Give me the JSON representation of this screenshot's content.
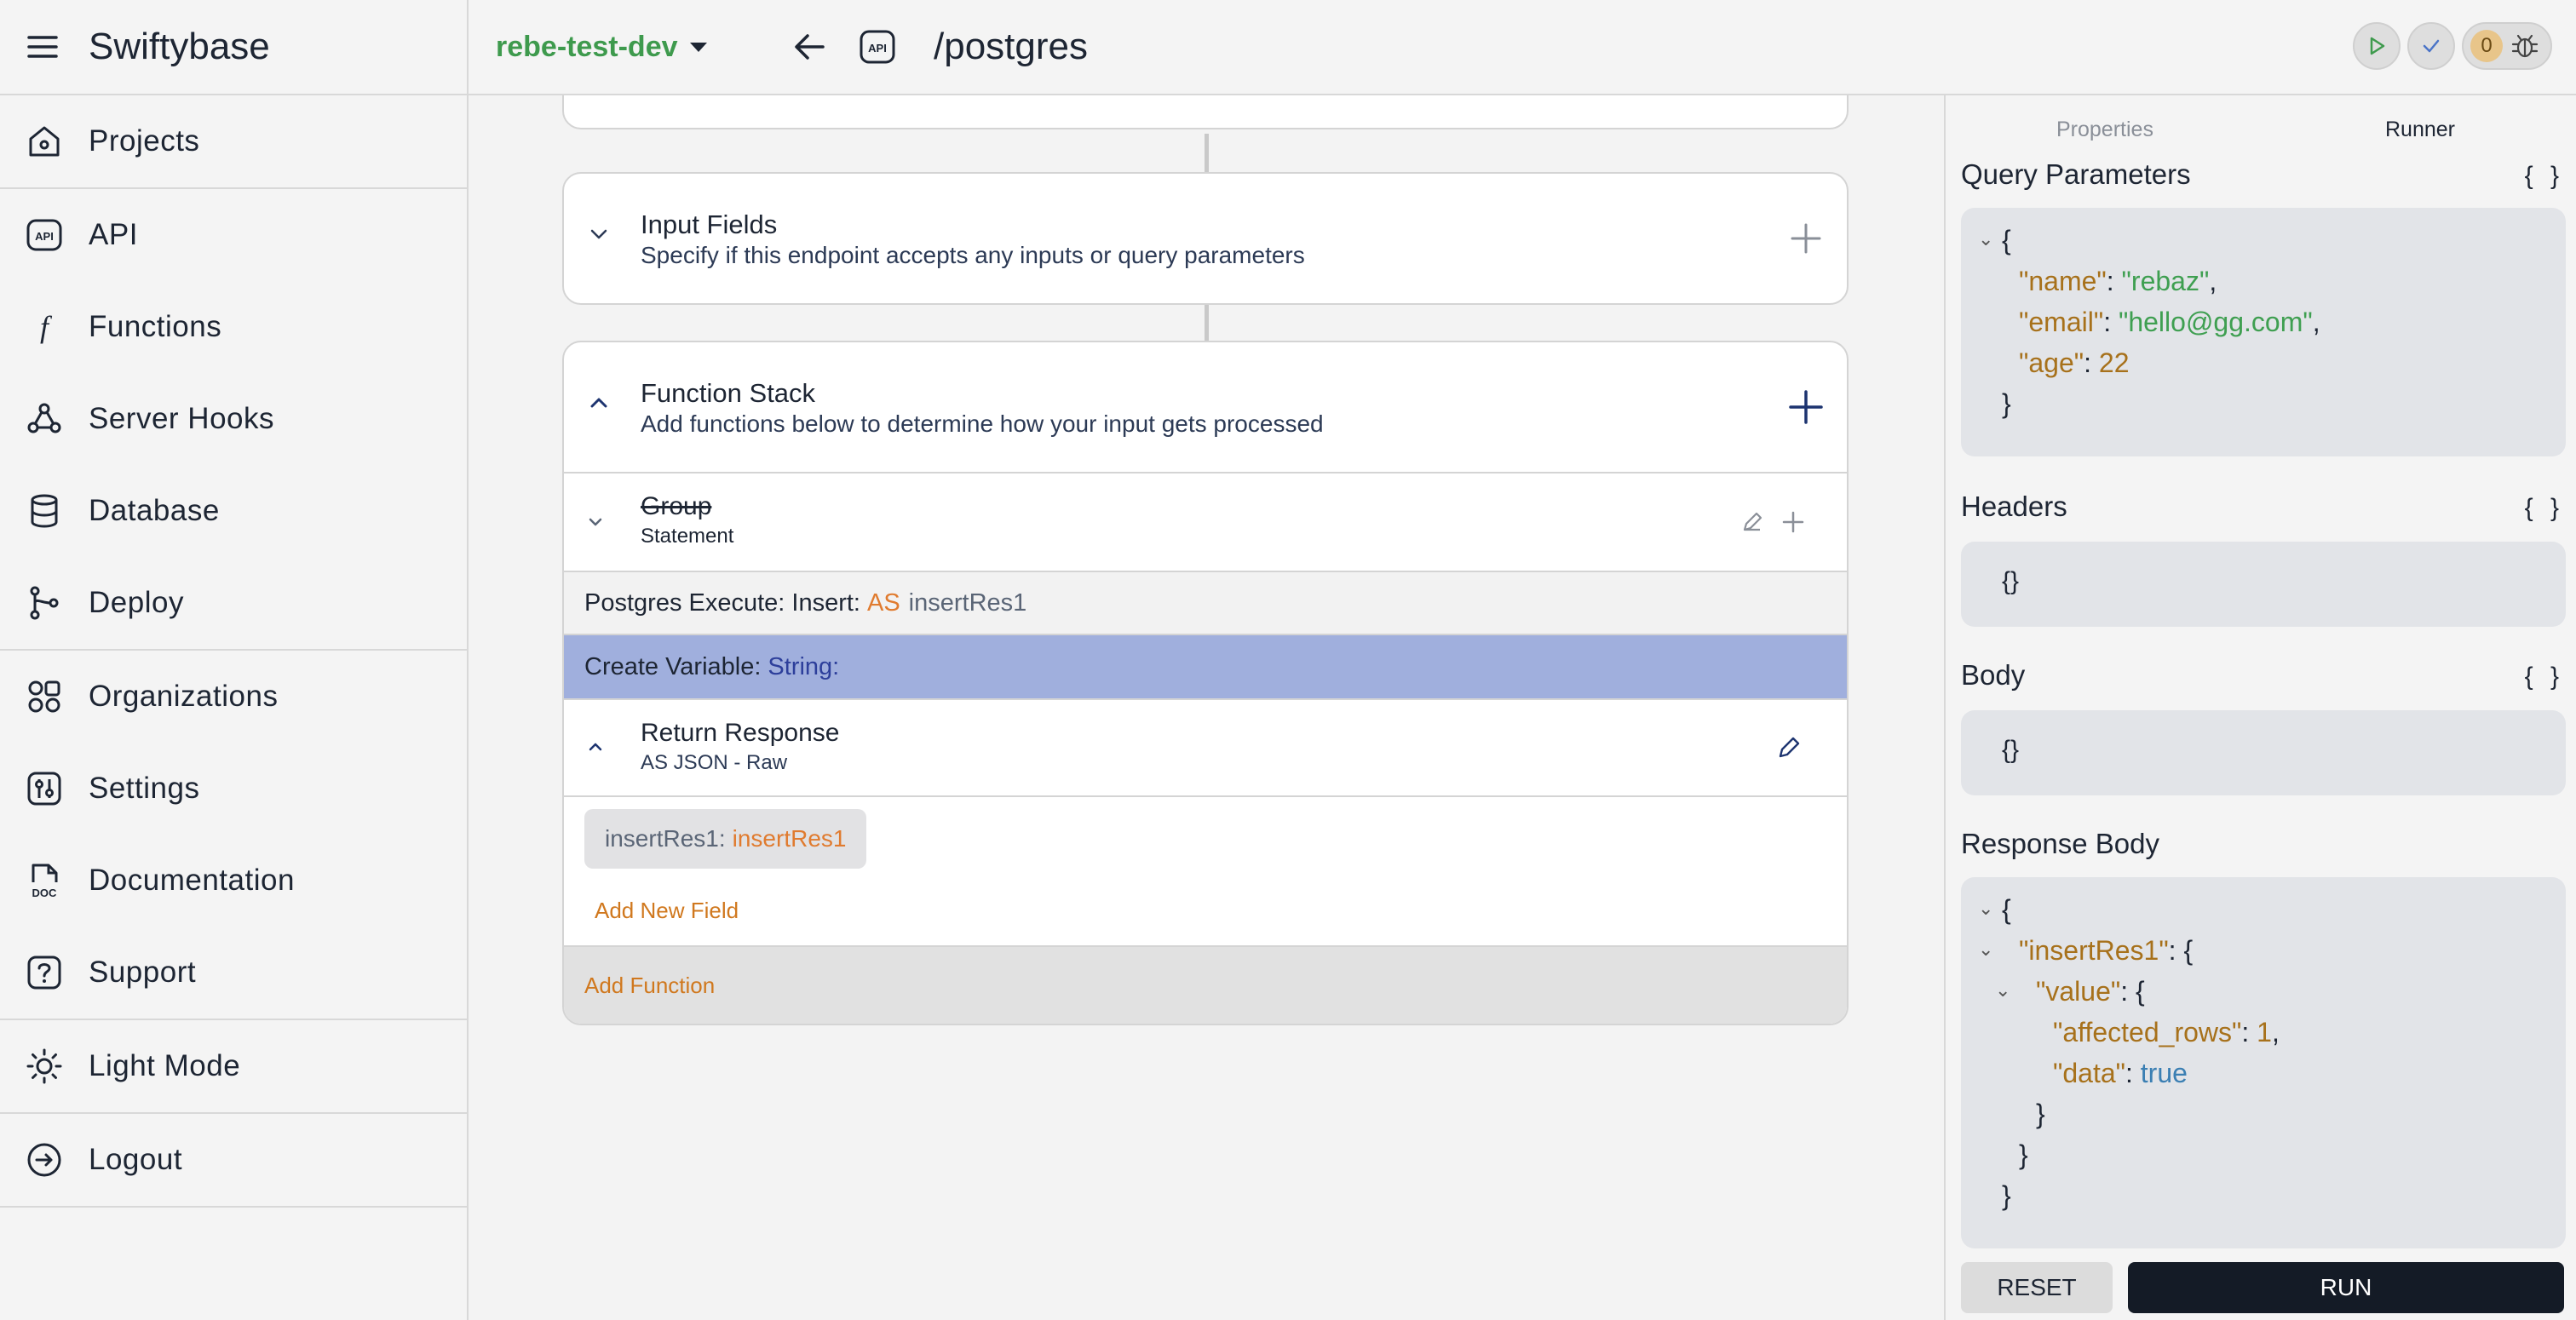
{
  "app": {
    "title": "Swiftybase"
  },
  "sidebar": {
    "items": [
      {
        "label": "Projects",
        "icon": "home-icon"
      },
      {
        "label": "API",
        "icon": "api-icon"
      },
      {
        "label": "Functions",
        "icon": "function-icon"
      },
      {
        "label": "Server Hooks",
        "icon": "webhook-icon"
      },
      {
        "label": "Database",
        "icon": "database-icon"
      },
      {
        "label": "Deploy",
        "icon": "git-branch-icon"
      },
      {
        "label": "Organizations",
        "icon": "shapes-icon"
      },
      {
        "label": "Settings",
        "icon": "settings-icon"
      },
      {
        "label": "Documentation",
        "icon": "doc-icon"
      },
      {
        "label": "Support",
        "icon": "help-icon"
      },
      {
        "label": "Light Mode",
        "icon": "sun-icon"
      },
      {
        "label": "Logout",
        "icon": "logout-icon"
      }
    ]
  },
  "topbar": {
    "branch": "rebe-test-dev",
    "api_badge": "API",
    "route": "/postgres",
    "debug_count": "0"
  },
  "main": {
    "input_fields": {
      "title": "Input Fields",
      "subtitle": "Specify if this endpoint accepts any inputs or query parameters"
    },
    "function_stack": {
      "title": "Function Stack",
      "subtitle": "Add functions below to determine how your input gets processed"
    },
    "group": {
      "title": "Group",
      "subtitle": "Statement"
    },
    "postgres_row": {
      "prefix": "Postgres Execute: Insert:",
      "as": "AS",
      "var": "insertRes1"
    },
    "create_variable": {
      "prefix": "Create Variable:",
      "type": "String:"
    },
    "return_response": {
      "title": "Return Response",
      "subtitle": "AS JSON - Raw"
    },
    "field_chip": {
      "key": "insertRes1:",
      "value": "insertRes1"
    },
    "add_field": "Add New Field",
    "add_function": "Add Function"
  },
  "runner": {
    "tabs": [
      "Properties",
      "Runner"
    ],
    "query_params": {
      "title": "Query Parameters",
      "braces": "{ }",
      "lines": {
        "open": "{",
        "name_key": "\"name\"",
        "name_val": "\"rebaz\"",
        "email_key": "\"email\"",
        "email_val": "\"hello@gg.com\"",
        "age_key": "\"age\"",
        "age_val": "22",
        "close": "}"
      }
    },
    "headers": {
      "title": "Headers",
      "braces": "{ }",
      "value": "{}"
    },
    "body": {
      "title": "Body",
      "braces": "{ }",
      "value": "{}"
    },
    "response": {
      "title": "Response Body",
      "lines": {
        "open": "{",
        "res_key": "\"insertRes1\"",
        "value_key": "\"value\"",
        "rows_key": "\"affected_rows\"",
        "rows_val": "1",
        "data_key": "\"data\"",
        "data_val": "true",
        "close": "}"
      }
    },
    "reset_label": "RESET",
    "run_label": "RUN"
  }
}
